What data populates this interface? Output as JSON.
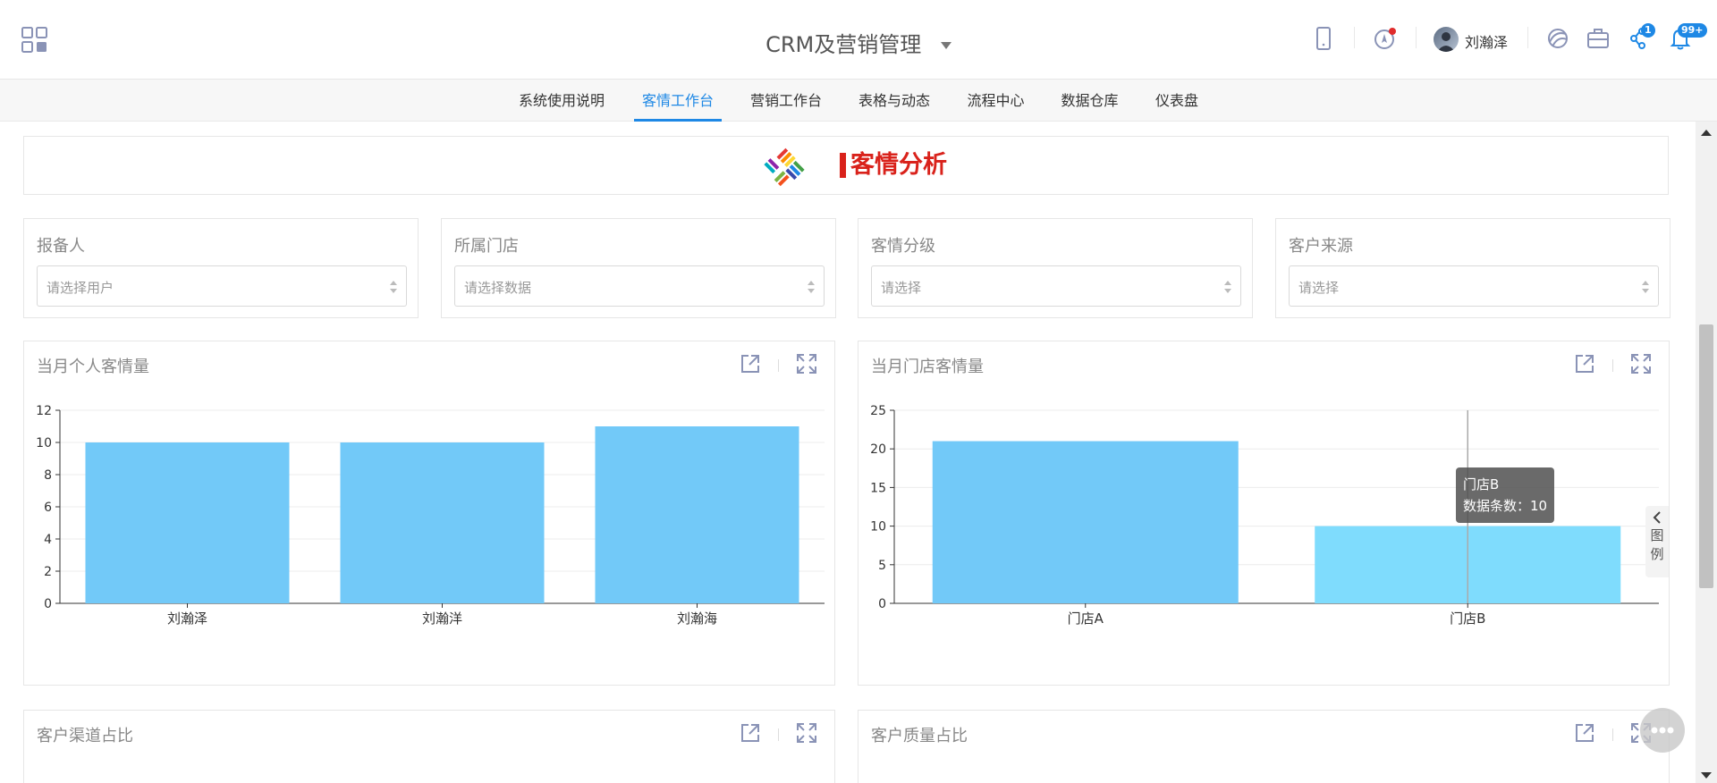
{
  "header": {
    "title": "CRM及营销管理",
    "user_name": "刘瀚泽",
    "icons": [
      "apps-grid-icon",
      "mobile-icon",
      "location-icon",
      "share-icon",
      "briefcase-icon",
      "workflow-icon",
      "bell-icon"
    ],
    "workflow_badge": "1",
    "bell_badge": "99+",
    "colors": {
      "accent": "#1e88e5",
      "badge_dot": "#e02b2b"
    }
  },
  "nav": {
    "tabs": [
      {
        "label": "系统使用说明"
      },
      {
        "label": "客情工作台"
      },
      {
        "label": "营销工作台"
      },
      {
        "label": "表格与动态"
      },
      {
        "label": "流程中心"
      },
      {
        "label": "数据仓库"
      },
      {
        "label": "仪表盘"
      }
    ],
    "active": "客情工作台"
  },
  "banner": {
    "title": "客情分析",
    "color": "#d9221b"
  },
  "filters": [
    {
      "label": "报备人",
      "placeholder": "请选择用户"
    },
    {
      "label": "所属门店",
      "placeholder": "请选择数据"
    },
    {
      "label": "客情分级",
      "placeholder": "请选择"
    },
    {
      "label": "客户来源",
      "placeholder": "请选择"
    }
  ],
  "chart_data": [
    {
      "type": "bar",
      "title": "当月个人客情量",
      "categories": [
        "刘瀚泽",
        "刘瀚洋",
        "刘瀚海"
      ],
      "values": [
        10,
        10,
        11
      ],
      "ylim": [
        0,
        12
      ],
      "yticks": [
        "0",
        "2",
        "4",
        "6",
        "8",
        "10",
        "12"
      ],
      "grid": true,
      "bar_color": "#72c9f8"
    },
    {
      "type": "bar",
      "title": "当月门店客情量",
      "categories": [
        "门店A",
        "门店B"
      ],
      "values": [
        21,
        10
      ],
      "ylim": [
        0,
        25
      ],
      "yticks": [
        "0",
        "5",
        "10",
        "15",
        "20",
        "25"
      ],
      "grid": true,
      "bar_color": "#72c9f8",
      "highlight_color": "#7fdcfd",
      "tooltip": {
        "title": "门店B",
        "line": "数据条数：10"
      },
      "legend_toggle": {
        "label_1": "图",
        "label_2": "例"
      }
    }
  ],
  "bottom_cards": [
    {
      "title": "客户渠道占比"
    },
    {
      "title": "客户质量占比"
    }
  ]
}
